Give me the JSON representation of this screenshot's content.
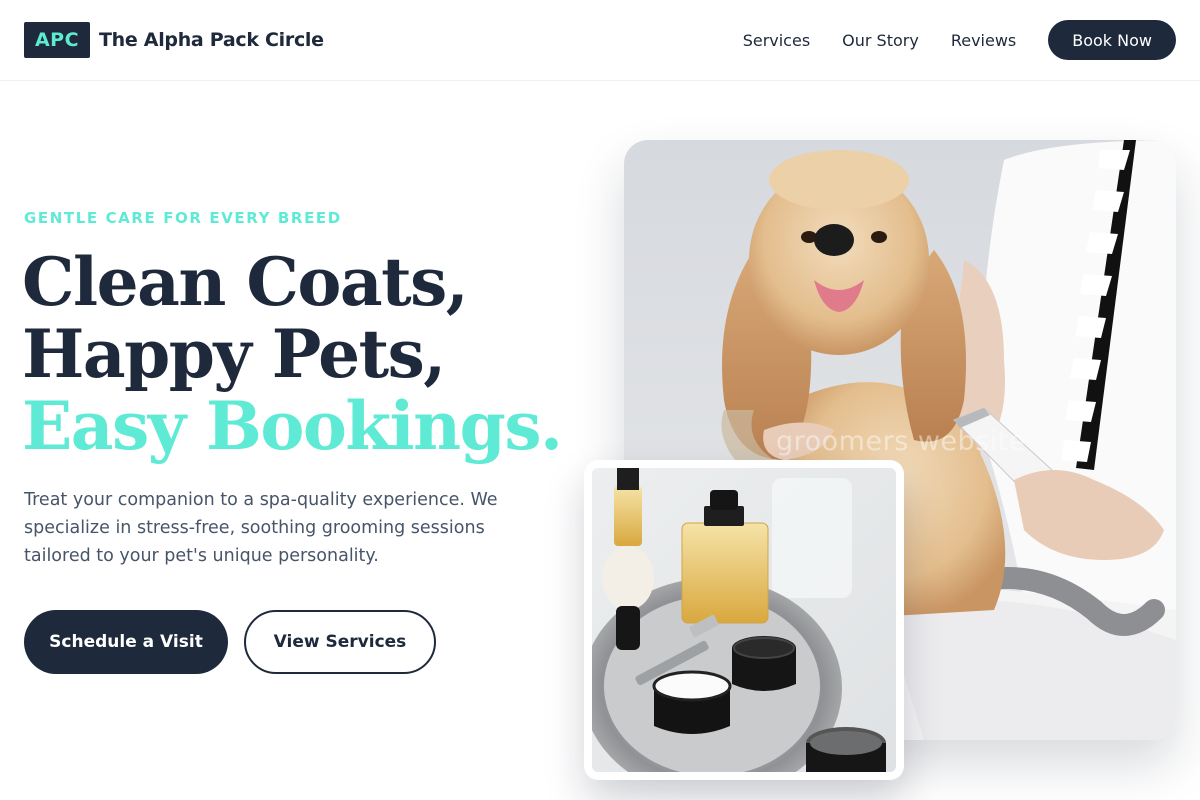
{
  "brand": {
    "badge": "APC",
    "name": "The Alpha Pack Circle",
    "accent_color": "#5eead4",
    "primary_color": "#1e293b"
  },
  "nav": {
    "items": [
      {
        "label": "Services"
      },
      {
        "label": "Our Story"
      },
      {
        "label": "Reviews"
      }
    ],
    "cta": "Book Now"
  },
  "hero": {
    "eyebrow": "GENTLE CARE FOR EVERY BREED",
    "headline_lines": [
      "Clean Coats,",
      "Happy Pets,"
    ],
    "headline_accent": "Easy Bookings.",
    "description": "Treat your companion to a spa-quality experience. We specialize in stress-free, soothing grooming sessions tailored to your pet's unique personality.",
    "primary_button": "Schedule a Visit",
    "secondary_button": "View Services",
    "main_image": {
      "subject": "cocker spaniel being groomed with clippers",
      "watermark": "groomers website"
    },
    "inset_image": {
      "subject": "grooming products on a stone tray"
    }
  }
}
